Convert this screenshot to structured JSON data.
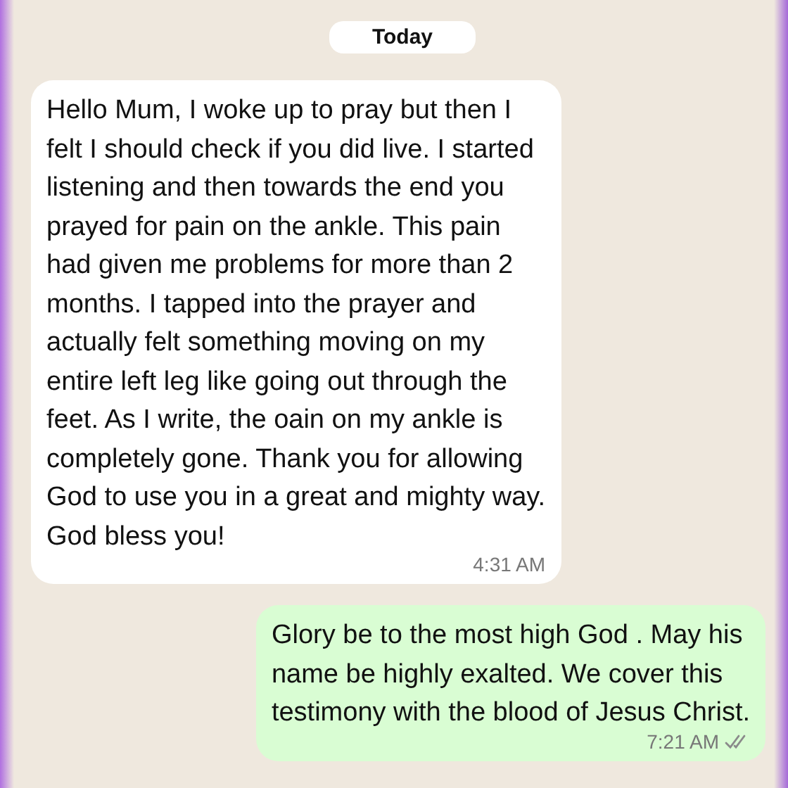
{
  "date_chip": "Today",
  "messages": [
    {
      "kind": "incoming",
      "text": "Hello Mum, I woke up to pray but then I\nfelt I should check if you did live. I started\nlistening and then towards the end you\nprayed for pain on the ankle. This pain\nhad given me problems for more than 2\nmonths. I tapped into the prayer and\nactually felt something moving on my\nentire left leg like going out through the\nfeet. As I write, the oain on my ankle is\ncompletely gone. Thank you for allowing\nGod to use you in a great and mighty way.\nGod bless you!",
      "time": "4:31 AM"
    },
    {
      "kind": "outgoing",
      "text": "Glory be to the most high God . May his\nname be highly exalted. We cover this\ntestimony with the blood of Jesus Christ.",
      "time": "7:21 AM",
      "read": false
    }
  ]
}
